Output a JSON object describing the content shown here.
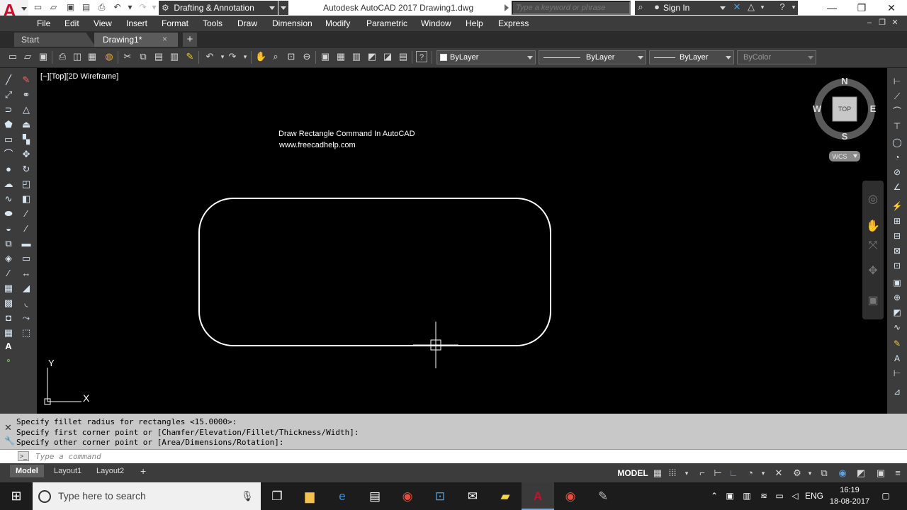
{
  "window": {
    "title": "Autodesk AutoCAD 2017   Drawing1.dwg",
    "workspace": "Drafting & Annotation",
    "search_placeholder": "Type a keyword or phrase",
    "sign_in": "Sign In"
  },
  "menu": [
    "File",
    "Edit",
    "View",
    "Insert",
    "Format",
    "Tools",
    "Draw",
    "Dimension",
    "Modify",
    "Parametric",
    "Window",
    "Help",
    "Express"
  ],
  "tabs": {
    "start": "Start",
    "drawing": "Drawing1*",
    "close": "×",
    "add": "+"
  },
  "properties": {
    "color": "ByLayer",
    "linetype": "ByLayer",
    "lineweight": "ByLayer",
    "plotstyle": "ByColor"
  },
  "viewport": {
    "label": "[−][Top][2D Wireframe]",
    "annotation_line1": "Draw Rectangle Command In AutoCAD",
    "annotation_line2": "www.freecadhelp.com",
    "viewcube": {
      "north": "N",
      "south": "S",
      "east": "E",
      "west": "W",
      "face": "TOP",
      "ucs": "WCS"
    },
    "ucs_axes": {
      "x": "X",
      "y": "Y"
    }
  },
  "command": {
    "history": [
      "Specify fillet radius for rectangles <15.0000>:",
      "Specify first corner point or [Chamfer/Elevation/Fillet/Thickness/Width]:",
      "Specify other corner point or [Area/Dimensions/Rotation]:"
    ],
    "input_placeholder": "Type a command",
    "prompt_icon": ">_"
  },
  "layout_tabs": [
    "Model",
    "Layout1",
    "Layout2"
  ],
  "layout_add": "+",
  "status": {
    "model": "MODEL"
  },
  "taskbar": {
    "search_placeholder": "Type here to search",
    "language": "ENG",
    "time": "16:19",
    "date": "18-08-2017"
  },
  "colors": {
    "autocad_red": "#c8102e",
    "ribbon_dark": "#3c3c3c",
    "canvas": "#000000",
    "command_bg": "#c8c8c8"
  }
}
